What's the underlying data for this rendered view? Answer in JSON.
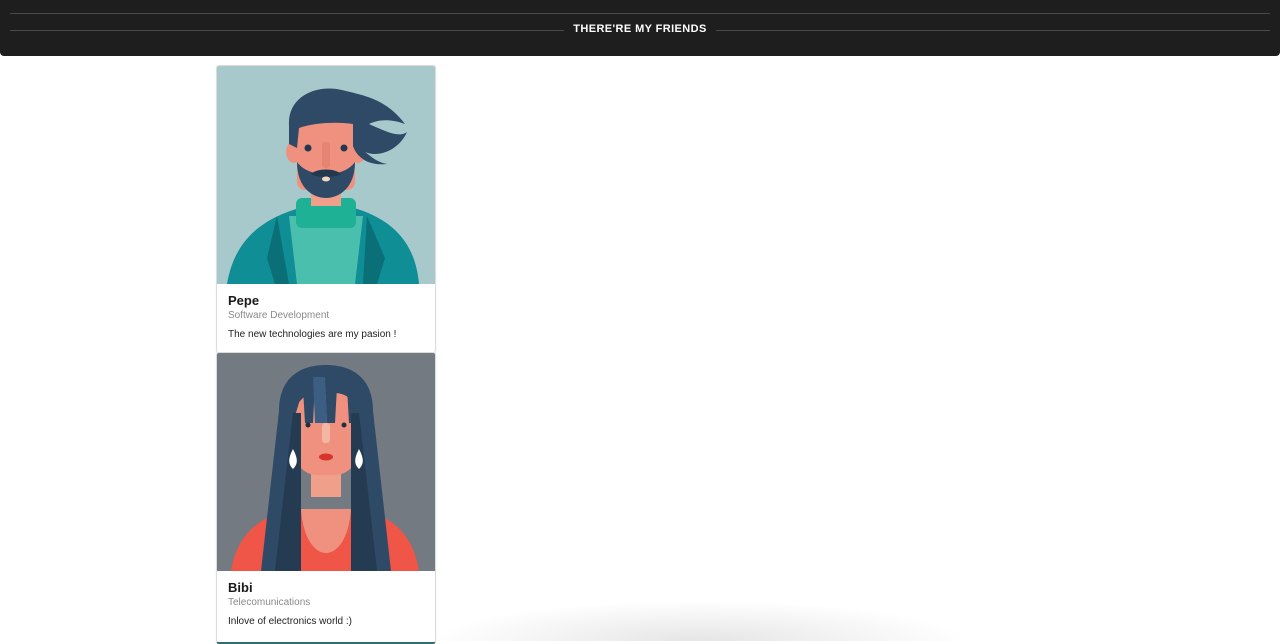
{
  "header": {
    "title": "THERE'RE MY FRIENDS"
  },
  "friends": [
    {
      "name": "Pepe",
      "role": "Software Development",
      "description": "The new technologies are my pasion !",
      "avatar_icon": "man-avatar-illustration",
      "avatar_bg": "#a8c9cb"
    },
    {
      "name": "Bibi",
      "role": "Telecomunications",
      "description": "Inlove of electronics world :)",
      "avatar_icon": "woman-avatar-illustration",
      "avatar_bg": "#737a82"
    }
  ],
  "colors": {
    "header_bg": "#1e1e1e",
    "header_text": "#ffffff",
    "role_text": "#8a8a8a"
  }
}
